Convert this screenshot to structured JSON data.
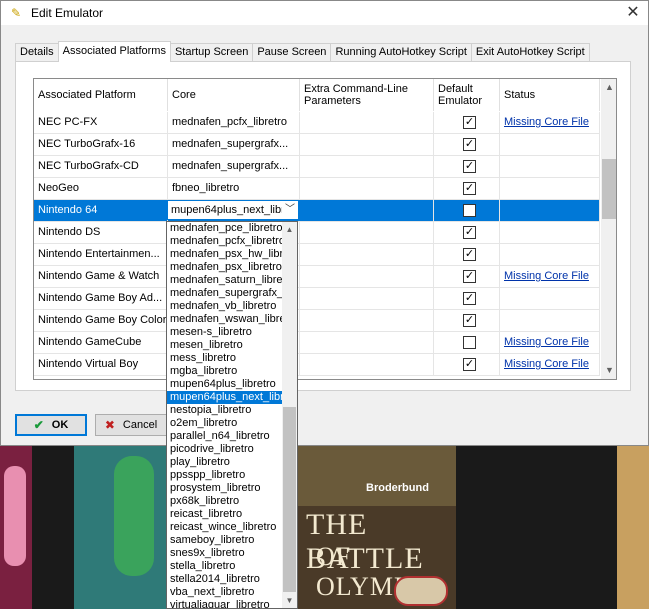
{
  "window": {
    "title": "Edit Emulator",
    "close_glyph": "✕"
  },
  "tabs": [
    "Details",
    "Associated Platforms",
    "Startup Screen",
    "Pause Screen",
    "Running AutoHotkey Script",
    "Exit AutoHotkey Script"
  ],
  "active_tab": "Associated Platforms",
  "grid": {
    "headers": [
      "Associated Platform",
      "Core",
      "Extra Command-Line Parameters",
      "Default Emulator",
      "Status"
    ],
    "rows": [
      {
        "platform": "NEC PC-FX",
        "core": "mednafen_pcfx_libretro",
        "default": true,
        "status": "Missing Core File"
      },
      {
        "platform": "NEC TurboGrafx-16",
        "core": "mednafen_supergrafx...",
        "default": true,
        "status": ""
      },
      {
        "platform": "NEC TurboGrafx-CD",
        "core": "mednafen_supergrafx...",
        "default": true,
        "status": ""
      },
      {
        "platform": "NeoGeo",
        "core": "fbneo_libretro",
        "default": true,
        "status": ""
      },
      {
        "platform": "Nintendo 64",
        "core": "mupen64plus_next_libr",
        "default": false,
        "status": "",
        "selected": true
      },
      {
        "platform": "Nintendo DS",
        "core": "",
        "default": true,
        "status": ""
      },
      {
        "platform": "Nintendo Entertainmen...",
        "core": "",
        "default": true,
        "status": ""
      },
      {
        "platform": "Nintendo Game & Watch",
        "core": "",
        "default": true,
        "status": "Missing Core File"
      },
      {
        "platform": "Nintendo Game Boy Ad...",
        "core": "",
        "default": true,
        "status": ""
      },
      {
        "platform": "Nintendo Game Boy Color",
        "core": "",
        "default": true,
        "status": ""
      },
      {
        "platform": "Nintendo GameCube",
        "core": "",
        "default": false,
        "status": "Missing Core File"
      },
      {
        "platform": "Nintendo Virtual Boy",
        "core": "",
        "default": true,
        "status": "Missing Core File"
      }
    ]
  },
  "combo": {
    "value": "mupen64plus_next_libr",
    "arrow": "﹀"
  },
  "dropdown": {
    "items": [
      "mednafen_pce_libretro",
      "mednafen_pcfx_libretro",
      "mednafen_psx_hw_libr",
      "mednafen_psx_libretro",
      "mednafen_saturn_libre",
      "mednafen_supergrafx_",
      "mednafen_vb_libretro",
      "mednafen_wswan_libre",
      "mesen-s_libretro",
      "mesen_libretro",
      "mess_libretro",
      "mgba_libretro",
      "mupen64plus_libretro",
      "mupen64plus_next_libr",
      "nestopia_libretro",
      "o2em_libretro",
      "parallel_n64_libretro",
      "picodrive_libretro",
      "play_libretro",
      "ppsspp_libretro",
      "prosystem_libretro",
      "px68k_libretro",
      "reicast_libretro",
      "reicast_wince_libretro",
      "sameboy_libretro",
      "snes9x_libretro",
      "stella_libretro",
      "stella2014_libretro",
      "vba_next_libretro",
      "virtualjaguar_libretro"
    ],
    "selected": "mupen64plus_next_libr"
  },
  "buttons": {
    "ok": "OK",
    "cancel": "Cancel"
  },
  "icons": {
    "window": "pencil-icon",
    "ok": "check-icon",
    "cancel": "cross-icon",
    "checkbox": "checkmark-icon"
  },
  "background_art": {
    "brand": "Broderbund",
    "title_line1": "THE BATTLE",
    "title_line2": "OF OLYMPUS",
    "seal": "Nintendo"
  },
  "colors": {
    "accent": "#0078d7",
    "link": "#0033aa",
    "selection": "#0078d7"
  }
}
